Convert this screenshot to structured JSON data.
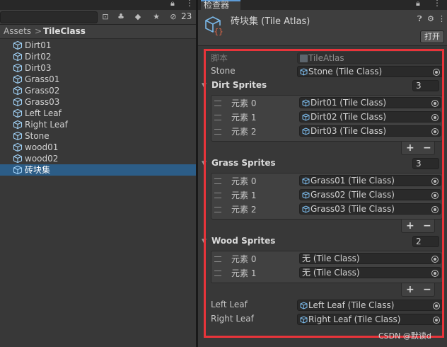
{
  "project": {
    "hidden_count": "23",
    "breadcrumb": {
      "root": "Assets",
      "separator": ">",
      "current": "TileClass"
    },
    "files": [
      "Dirt01",
      "Dirt02",
      "Dirt03",
      "Grass01",
      "Grass02",
      "Grass03",
      "Left Leaf",
      "Right Leaf",
      "Stone",
      "wood01",
      "wood02",
      "砖块集"
    ],
    "selected_index": 11
  },
  "inspector": {
    "tab_label": "检查器",
    "title": "砖块集 (Tile Atlas)",
    "open_button": "打开",
    "script_label": "脚本",
    "script_value": "TileAtlas",
    "stone_label": "Stone",
    "stone_value": "Stone (Tile Class)",
    "dirt": {
      "header": "Dirt Sprites",
      "count": "3",
      "elements": [
        {
          "label": "元素 0",
          "value": "Dirt01 (Tile Class)"
        },
        {
          "label": "元素 1",
          "value": "Dirt02 (Tile Class)"
        },
        {
          "label": "元素 2",
          "value": "Dirt03 (Tile Class)"
        }
      ]
    },
    "grass": {
      "header": "Grass Sprites",
      "count": "3",
      "elements": [
        {
          "label": "元素 0",
          "value": "Grass01 (Tile Class)"
        },
        {
          "label": "元素 1",
          "value": "Grass02 (Tile Class)"
        },
        {
          "label": "元素 2",
          "value": "Grass03 (Tile Class)"
        }
      ]
    },
    "wood": {
      "header": "Wood Sprites",
      "count": "2",
      "elements": [
        {
          "label": "元素 0",
          "value": "无 (Tile Class)"
        },
        {
          "label": "元素 1",
          "value": "无 (Tile Class)"
        }
      ]
    },
    "left_leaf_label": "Left Leaf",
    "left_leaf_value": "Left Leaf (Tile Class)",
    "right_leaf_label": "Right Leaf",
    "right_leaf_value": "Right Leaf (Tile Class)",
    "plus": "+",
    "minus": "−"
  },
  "watermark": "CSDN @默读d",
  "colors": {
    "accent": "#2c5d87",
    "highlight_box": "#e8343a",
    "panel": "#383838"
  }
}
